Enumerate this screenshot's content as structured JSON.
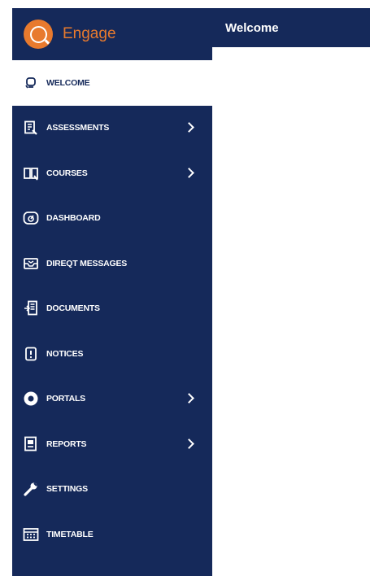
{
  "app": {
    "name": "Engage"
  },
  "header": {
    "title": "Welcome"
  },
  "colors": {
    "navy": "#15295a",
    "orange": "#e87a2e",
    "white": "#ffffff"
  },
  "sidebar": {
    "items": [
      {
        "label": "WELCOME",
        "icon": "welcome-icon",
        "active": true,
        "has_submenu": false
      },
      {
        "label": "ASSESSMENTS",
        "icon": "assessments-icon",
        "active": false,
        "has_submenu": true
      },
      {
        "label": "COURSES",
        "icon": "courses-icon",
        "active": false,
        "has_submenu": true
      },
      {
        "label": "DASHBOARD",
        "icon": "dashboard-icon",
        "active": false,
        "has_submenu": false
      },
      {
        "label": "DIREQT MESSAGES",
        "icon": "messages-icon",
        "active": false,
        "has_submenu": false
      },
      {
        "label": "DOCUMENTS",
        "icon": "documents-icon",
        "active": false,
        "has_submenu": false
      },
      {
        "label": "NOTICES",
        "icon": "notices-icon",
        "active": false,
        "has_submenu": false
      },
      {
        "label": "PORTALS",
        "icon": "portals-icon",
        "active": false,
        "has_submenu": true
      },
      {
        "label": "REPORTS",
        "icon": "reports-icon",
        "active": false,
        "has_submenu": true
      },
      {
        "label": "SETTINGS",
        "icon": "wrench-icon",
        "active": false,
        "has_submenu": false
      },
      {
        "label": "TIMETABLE",
        "icon": "timetable-icon",
        "active": false,
        "has_submenu": false
      }
    ]
  }
}
